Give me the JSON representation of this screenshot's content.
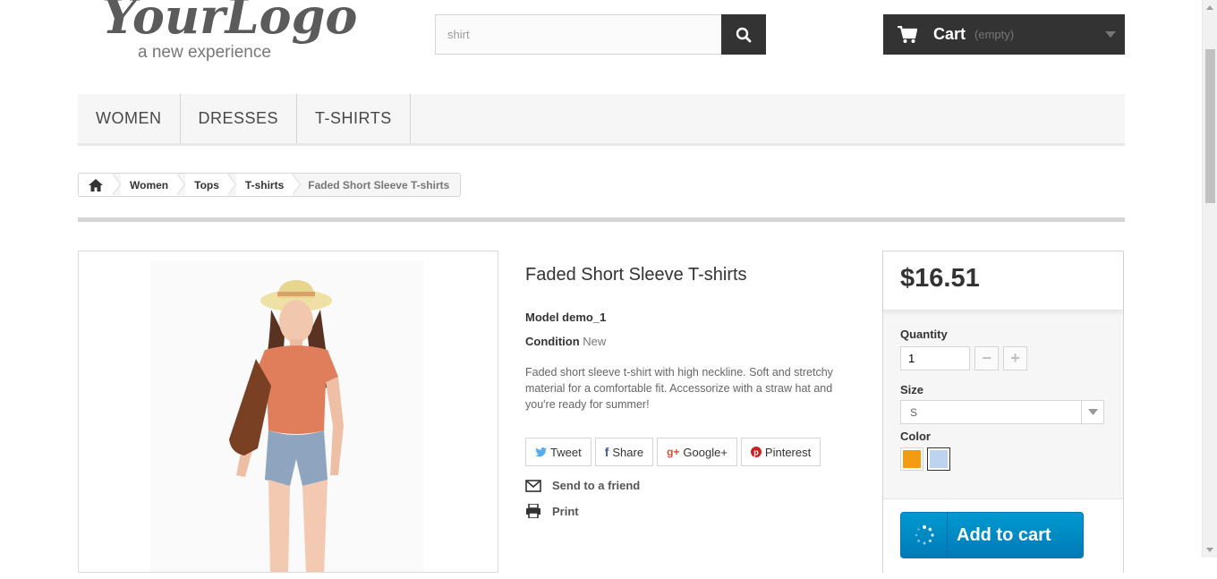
{
  "header": {
    "logo_main": "YourLogo",
    "logo_tagline": "a new experience",
    "search": {
      "value": "shirt",
      "icon": "search-icon"
    },
    "cart": {
      "label": "Cart",
      "status": "(empty)",
      "icon": "shopping-cart-icon"
    }
  },
  "menu": {
    "items": [
      "WOMEN",
      "DRESSES",
      "T-SHIRTS"
    ]
  },
  "breadcrumb": {
    "home_icon": "home-icon",
    "items": [
      "Women",
      "Tops",
      "T-shirts"
    ],
    "current": "Faded Short Sleeve T-shirts"
  },
  "product": {
    "title": "Faded Short Sleeve T-shirts",
    "model_label": "Model demo_1",
    "condition_label": "Condition",
    "condition_value": "New",
    "description": "Faded short sleeve t-shirt with high neckline. Soft and stretchy material for a comfortable fit. Accessorize with a straw hat and you're ready for summer!",
    "social": [
      {
        "label": "Tweet",
        "icon": "twitter-icon"
      },
      {
        "label": "Share",
        "icon": "facebook-icon"
      },
      {
        "label": "Google+",
        "icon": "google-plus-icon"
      },
      {
        "label": "Pinterest",
        "icon": "pinterest-icon"
      }
    ],
    "send_to_friend": "Send to a friend",
    "print": "Print"
  },
  "buy_box": {
    "price": "$16.51",
    "quantity_label": "Quantity",
    "quantity_value": "1",
    "size_label": "Size",
    "size_value": "S",
    "color_label": "Color",
    "colors": [
      "#f39c11",
      "#bdd4f1"
    ],
    "add_to_cart": "Add to cart"
  },
  "colors": {
    "dark": "#333333",
    "accent_blue": "#0088c8"
  }
}
